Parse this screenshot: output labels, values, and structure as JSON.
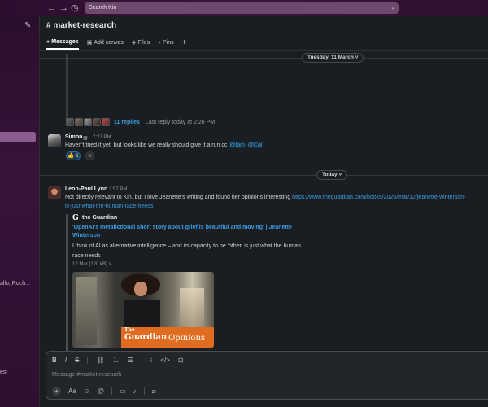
{
  "topbar": {
    "back_icon": "arrow-left",
    "forward_icon": "arrow-right",
    "history_icon": "clock",
    "search_placeholder": "Search Kin"
  },
  "sidebar": {
    "compose_icon": "edit",
    "fragments": [
      {
        "text": "allo, Roch..."
      },
      {
        "text": "est"
      }
    ]
  },
  "channel": {
    "name": "# market-research",
    "tabs": [
      {
        "label": "Messages",
        "icon": "message-bubble",
        "active": true
      },
      {
        "label": "Add canvas",
        "icon": "canvas",
        "active": false
      },
      {
        "label": "Files",
        "icon": "layers",
        "active": false
      },
      {
        "label": "Pins",
        "icon": "pin",
        "active": false
      }
    ],
    "add_tab_icon": "plus"
  },
  "thread_summary": {
    "replies": "11 replies",
    "last_reply": "Last reply today at 2:26 PM"
  },
  "date_dividers": {
    "first": "Tuesday, 11 March",
    "second": "Today"
  },
  "messages": [
    {
      "author": "Simon",
      "time": "7:27 PM",
      "text_prefix": "Haven't tried it yet, but looks like we really should give it a run cc ",
      "mentions": [
        "@Iain",
        "@Cal"
      ],
      "reactions": [
        {
          "emoji": "👍",
          "count": "1"
        }
      ]
    },
    {
      "author": "Leon-Paul Lynn",
      "time": "2:57 PM",
      "text": "Not directly relevant to Kin, but I love Jeanette's writing and found her opinions interesting ",
      "link_line1": "https://www.theguardian.com/books/2025/mar/12/jeanette-winterson-",
      "link_line2": "is-just-what-the-human-race-needs",
      "unfurl": {
        "source": "the Guardian",
        "title": "'OpenAI's metafictional short story about grief is beautiful and moving' | Jeanette Winterson",
        "description": "I think of AI as alternative intelligence – and its capacity to be 'other' is just what the human race needs",
        "meta": "12 Mar (120 kB)",
        "image_brand_small": "The",
        "image_brand_large": "Guardian",
        "image_brand_suffix": "Opinions"
      }
    }
  ],
  "composer": {
    "placeholder": "Message #market-research",
    "format_icons": [
      "bold",
      "italic",
      "strikethrough",
      "link",
      "ordered-list",
      "bulleted-list",
      "quote",
      "code",
      "code-block"
    ],
    "action_icons": [
      "plus",
      "text-format",
      "emoji",
      "mention",
      "video",
      "microphone",
      "slash-command"
    ]
  },
  "colors": {
    "topbar": "#3a1539",
    "sidebar": "#361438",
    "background": "#1a1d21",
    "link": "#3c9de0",
    "guardian_orange": "#e06c1f"
  }
}
